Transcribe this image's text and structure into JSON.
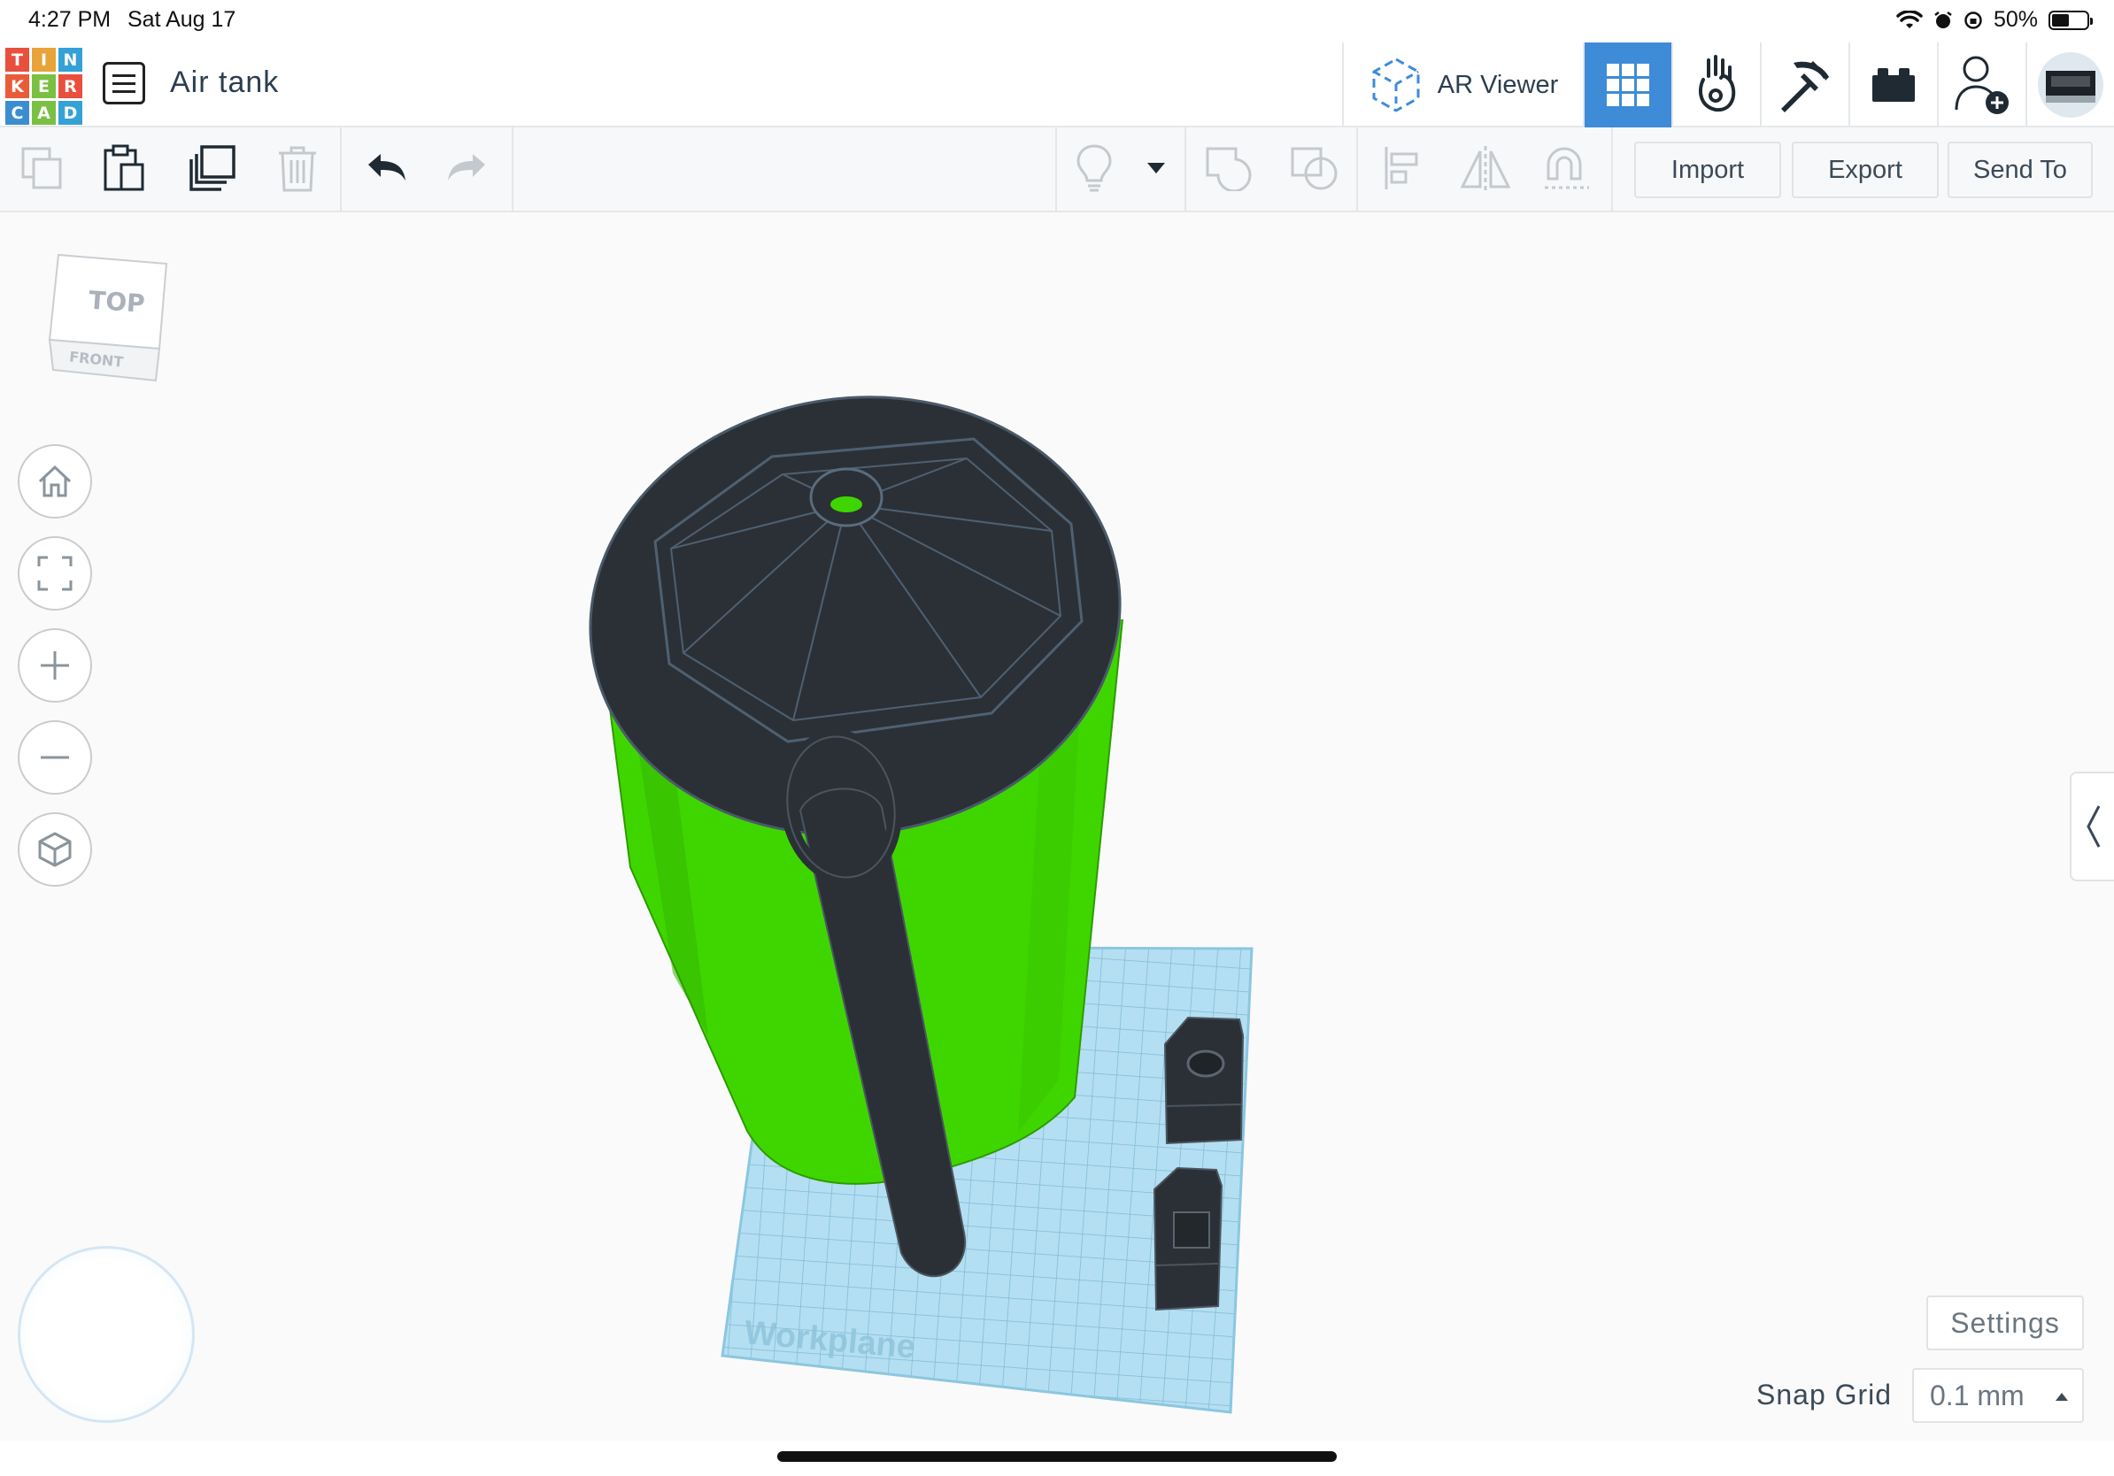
{
  "status_bar": {
    "time": "4:27 PM",
    "date": "Sat Aug 17",
    "battery": "50%",
    "icons": [
      "wifi-icon",
      "alarm-icon",
      "orientation-lock-icon",
      "battery-icon"
    ]
  },
  "header": {
    "logo_letters": [
      "T",
      "I",
      "N",
      "K",
      "E",
      "R",
      "C",
      "A",
      "D"
    ],
    "design_title": "Air tank",
    "ar_viewer_label": "AR Viewer"
  },
  "toolbar": {
    "import_label": "Import",
    "export_label": "Export",
    "send_to_label": "Send To"
  },
  "view_cube": {
    "top_label": "TOP",
    "front_label": "FRONT"
  },
  "workplane": {
    "label": "Workplane"
  },
  "bottom_right": {
    "settings_label": "Settings",
    "snap_grid_label": "Snap Grid",
    "snap_grid_value": "0.1 mm"
  },
  "colors": {
    "accent": "#3e8bd8",
    "shape_green": "#3fd600",
    "shape_dark": "#2b3036",
    "workplane": "#a8d8ef"
  }
}
